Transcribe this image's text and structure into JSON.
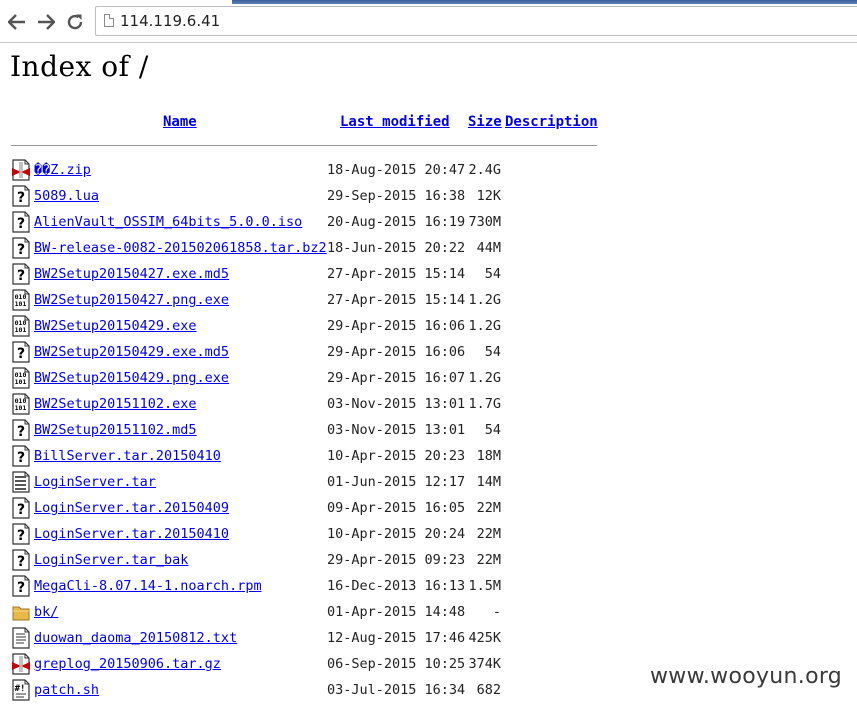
{
  "browser": {
    "url": "114.119.6.41",
    "back_icon": "back-arrow-icon",
    "forward_icon": "forward-arrow-icon",
    "reload_icon": "reload-icon"
  },
  "page": {
    "title": "Index of /",
    "headers": {
      "name": "Name",
      "last_modified": "Last modified",
      "size": "Size",
      "description": "Description"
    },
    "files": [
      {
        "name": "��Z.zip",
        "date": "18-Aug-2015 20:47",
        "size": "2.4G",
        "icon": "compressed"
      },
      {
        "name": "5089.lua",
        "date": "29-Sep-2015 16:38",
        "size": "12K",
        "icon": "unknown"
      },
      {
        "name": "AlienVault_OSSIM_64bits_5.0.0.iso",
        "date": "20-Aug-2015 16:19",
        "size": "730M",
        "icon": "unknown"
      },
      {
        "name": "BW-release-0082-201502061858.tar.bz2",
        "date": "18-Jun-2015 20:22",
        "size": "44M",
        "icon": "unknown"
      },
      {
        "name": "BW2Setup20150427.exe.md5",
        "date": "27-Apr-2015 15:14",
        "size": "54",
        "icon": "unknown"
      },
      {
        "name": "BW2Setup20150427.png.exe",
        "date": "27-Apr-2015 15:14",
        "size": "1.2G",
        "icon": "binary"
      },
      {
        "name": "BW2Setup20150429.exe",
        "date": "29-Apr-2015 16:06",
        "size": "1.2G",
        "icon": "binary"
      },
      {
        "name": "BW2Setup20150429.exe.md5",
        "date": "29-Apr-2015 16:06",
        "size": "54",
        "icon": "unknown"
      },
      {
        "name": "BW2Setup20150429.png.exe",
        "date": "29-Apr-2015 16:07",
        "size": "1.2G",
        "icon": "binary"
      },
      {
        "name": "BW2Setup20151102.exe",
        "date": "03-Nov-2015 13:01",
        "size": "1.7G",
        "icon": "binary"
      },
      {
        "name": "BW2Setup20151102.md5",
        "date": "03-Nov-2015 13:01",
        "size": "54",
        "icon": "unknown"
      },
      {
        "name": "BillServer.tar.20150410",
        "date": "10-Apr-2015 20:23",
        "size": "18M",
        "icon": "unknown"
      },
      {
        "name": "LoginServer.tar",
        "date": "01-Jun-2015 12:17",
        "size": "14M",
        "icon": "tar"
      },
      {
        "name": "LoginServer.tar.20150409",
        "date": "09-Apr-2015 16:05",
        "size": "22M",
        "icon": "unknown"
      },
      {
        "name": "LoginServer.tar.20150410",
        "date": "10-Apr-2015 20:24",
        "size": "22M",
        "icon": "unknown"
      },
      {
        "name": "LoginServer.tar_bak",
        "date": "29-Apr-2015 09:23",
        "size": "22M",
        "icon": "unknown"
      },
      {
        "name": "MegaCli-8.07.14-1.noarch.rpm",
        "date": "16-Dec-2013 16:13",
        "size": "1.5M",
        "icon": "unknown"
      },
      {
        "name": "bk/",
        "date": "01-Apr-2015 14:48",
        "size": "-",
        "icon": "folder"
      },
      {
        "name": "duowan_daoma_20150812.txt",
        "date": "12-Aug-2015 17:46",
        "size": "425K",
        "icon": "text"
      },
      {
        "name": "greplog_20150906.tar.gz",
        "date": "06-Sep-2015 10:25",
        "size": "374K",
        "icon": "compressed"
      },
      {
        "name": "patch.sh",
        "date": "03-Jul-2015 16:34",
        "size": "682",
        "icon": "script"
      }
    ]
  },
  "watermark": "www.wooyun.org"
}
